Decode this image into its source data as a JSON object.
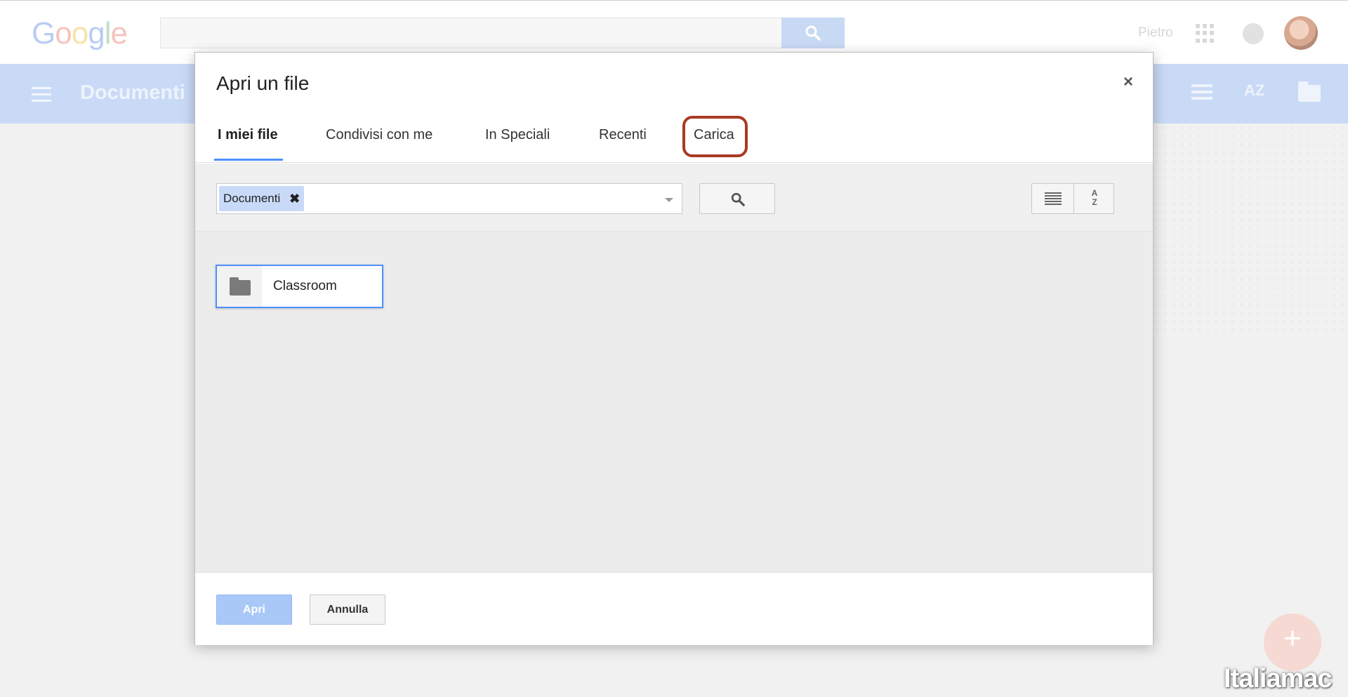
{
  "background": {
    "logo": {
      "letters": [
        "G",
        "o",
        "o",
        "g",
        "l",
        "e"
      ],
      "colors": [
        "#b9cdf3",
        "#f5c4bd",
        "#f7e3a6",
        "#b9cdf3",
        "#bfe0c6",
        "#f5c4bd"
      ]
    },
    "user_name": "Pietro",
    "app_title": "Documenti",
    "sort_label": "AZ",
    "fab_symbol": "+",
    "watermark": "Italiamac"
  },
  "dialog": {
    "title": "Apri un file",
    "close_symbol": "×",
    "tabs": [
      {
        "label": "I miei file",
        "active": true
      },
      {
        "label": "Condivisi con me",
        "active": false
      },
      {
        "label": "In Speciali",
        "active": false
      },
      {
        "label": "Recenti",
        "active": false
      },
      {
        "label": "Carica",
        "active": false,
        "highlighted": true
      }
    ],
    "path_chip": {
      "label": "Documenti",
      "remove_symbol": "✖"
    },
    "sort_button": {
      "line1": "A",
      "line2": "Z"
    },
    "items": [
      {
        "name": "Classroom",
        "type": "folder",
        "selected": true
      }
    ],
    "buttons": {
      "open": "Apri",
      "cancel": "Annulla"
    }
  },
  "colors": {
    "accent": "#4d90fe",
    "highlight_ring": "#a93a22",
    "app_bar": "#c9daf7"
  },
  "icons": [
    "search-icon",
    "apps-icon",
    "notifications-icon",
    "menu-icon",
    "list-view-icon",
    "sort-az-icon",
    "folder-icon",
    "close-icon",
    "dropdown-arrow-icon"
  ]
}
